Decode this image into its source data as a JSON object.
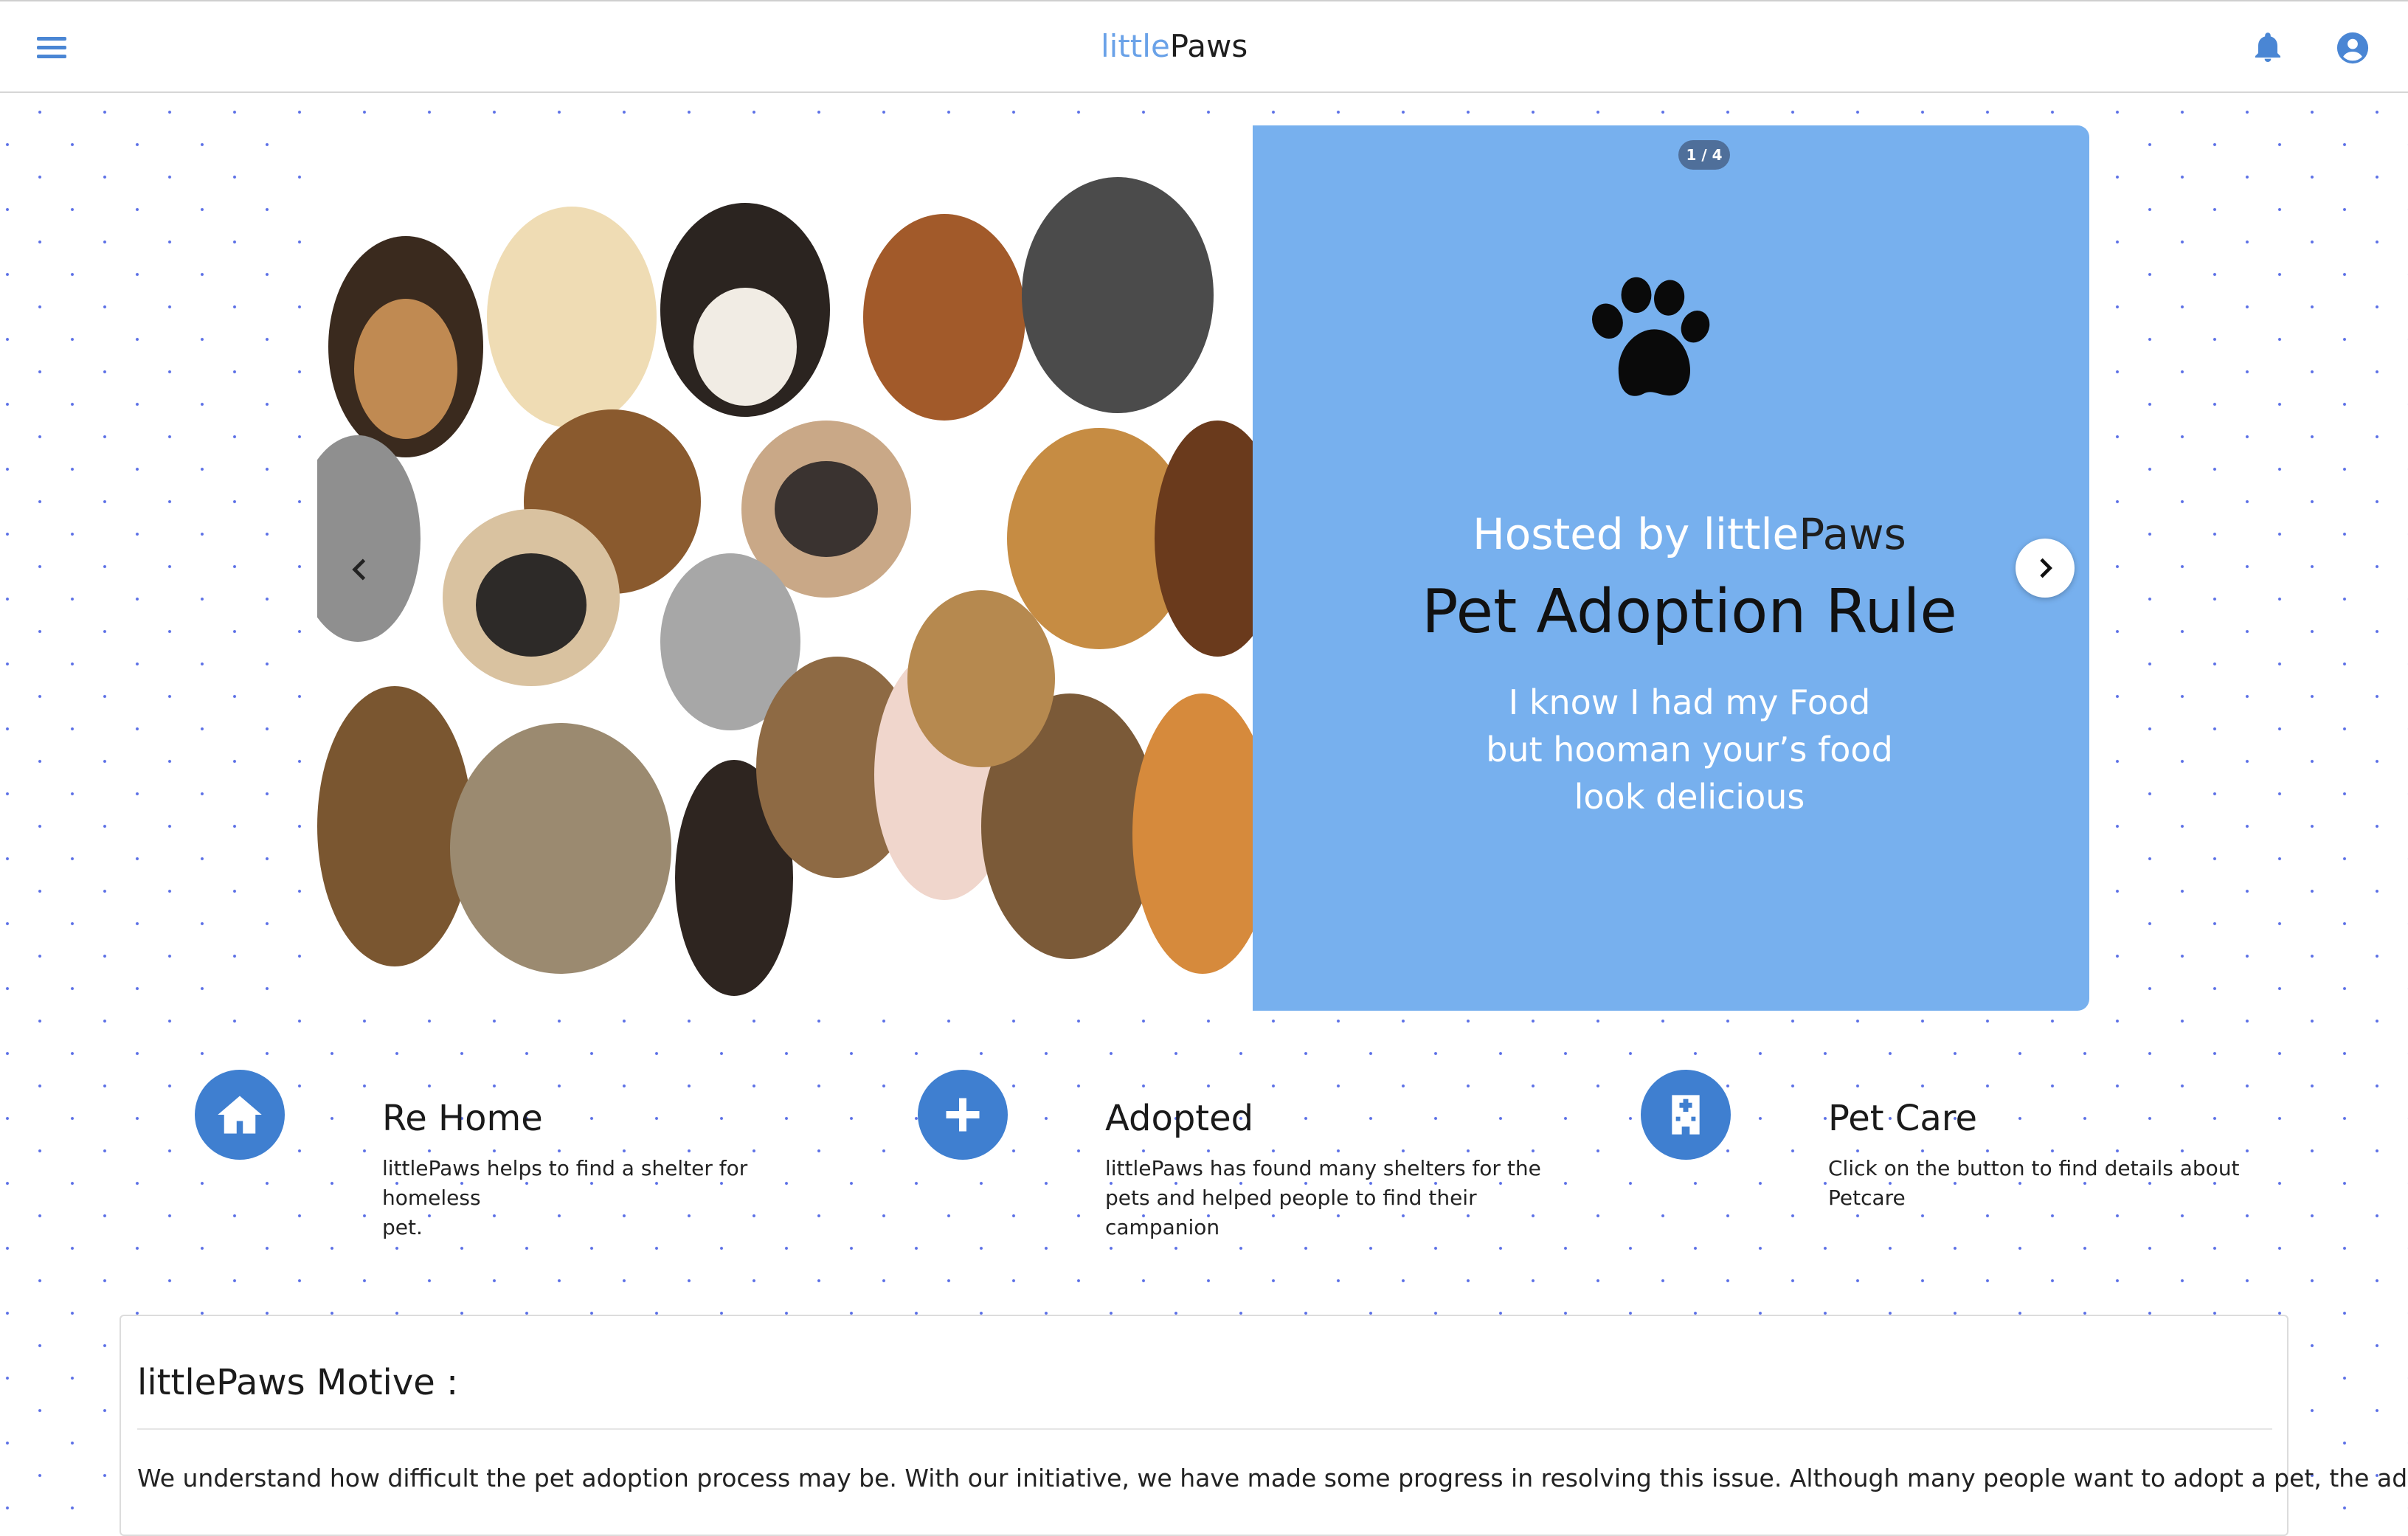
{
  "header": {
    "brand_light": "little",
    "brand_dark": "Paws",
    "menu_icon": "hamburger-menu-icon",
    "notification_icon": "bell-icon",
    "account_icon": "user-circle-icon"
  },
  "carousel": {
    "counter": "1 / 4",
    "hosted_prefix": "Hosted by little",
    "hosted_brand": "Paws",
    "title": "Pet Adoption Rule",
    "line1": "I know I had my Food",
    "line2": "but hooman your’s food",
    "line3": "look delicious",
    "card_color": "#77b0ee",
    "prev_icon": "chevron-left-icon",
    "next_icon": "chevron-right-icon"
  },
  "features": [
    {
      "icon": "home-icon",
      "title": "Re Home",
      "line1": "littlePaws helps to find a shelter for homeless",
      "line2": "pet."
    },
    {
      "icon": "plus-icon",
      "title": "Adopted",
      "line1": "littlePaws has found many shelters for the",
      "line2": "pets and helped people to find their",
      "line3": "campanion"
    },
    {
      "icon": "hospital-icon",
      "title": "Pet Care",
      "line1": "Click on the button to find details about",
      "line2": "Petcare"
    }
  ],
  "motive": {
    "title": "littlePaws Motive :",
    "text": "We understand how difficult the pet adoption process may be. With our initiative, we have made some progress in resolving this issue. Although many people want to adopt a pet, the adoption"
  },
  "colors": {
    "accent": "#3f7fd0",
    "brand_light": "#6aa2e8"
  }
}
